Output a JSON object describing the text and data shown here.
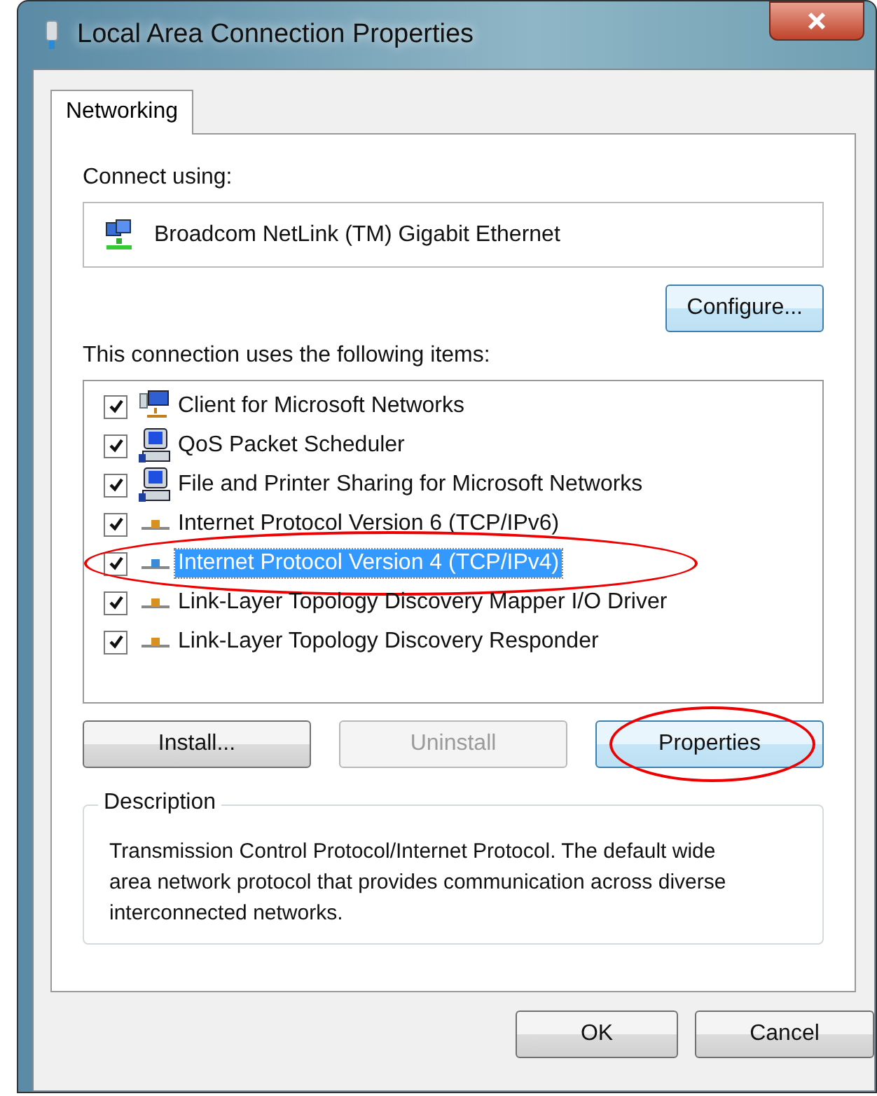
{
  "window": {
    "title": "Local Area Connection Properties"
  },
  "tabs": [
    {
      "label": "Networking",
      "selected": true
    }
  ],
  "connect_using": {
    "label": "Connect using:",
    "adapter": "Broadcom NetLink (TM) Gigabit Ethernet"
  },
  "configure_button": "Configure...",
  "items_label": "This connection uses the following items:",
  "items": [
    {
      "kind": "client",
      "label": "Client for Microsoft Networks",
      "checked": true,
      "selected": false,
      "circled": false
    },
    {
      "kind": "service",
      "label": "QoS Packet Scheduler",
      "checked": true,
      "selected": false,
      "circled": false
    },
    {
      "kind": "service",
      "label": "File and Printer Sharing for Microsoft Networks",
      "checked": true,
      "selected": false,
      "circled": false
    },
    {
      "kind": "protocol",
      "label": "Internet Protocol Version 6 (TCP/IPv6)",
      "checked": true,
      "selected": false,
      "circled": false
    },
    {
      "kind": "protocol",
      "label": "Internet Protocol Version 4 (TCP/IPv4)",
      "checked": true,
      "selected": true,
      "circled": true
    },
    {
      "kind": "protocol",
      "label": "Link-Layer Topology Discovery Mapper I/O Driver",
      "checked": true,
      "selected": false,
      "circled": false
    },
    {
      "kind": "protocol",
      "label": "Link-Layer Topology Discovery Responder",
      "checked": true,
      "selected": false,
      "circled": false
    }
  ],
  "item_buttons": [
    {
      "label": "Install...",
      "disabled": false,
      "circled": false
    },
    {
      "label": "Uninstall",
      "disabled": true,
      "circled": false
    },
    {
      "label": "Properties",
      "disabled": false,
      "circled": true
    }
  ],
  "description": {
    "title": "Description",
    "text": "Transmission Control Protocol/Internet Protocol. The default wide area network protocol that provides communication across diverse interconnected networks."
  },
  "dialog_buttons": [
    "OK",
    "Cancel"
  ]
}
